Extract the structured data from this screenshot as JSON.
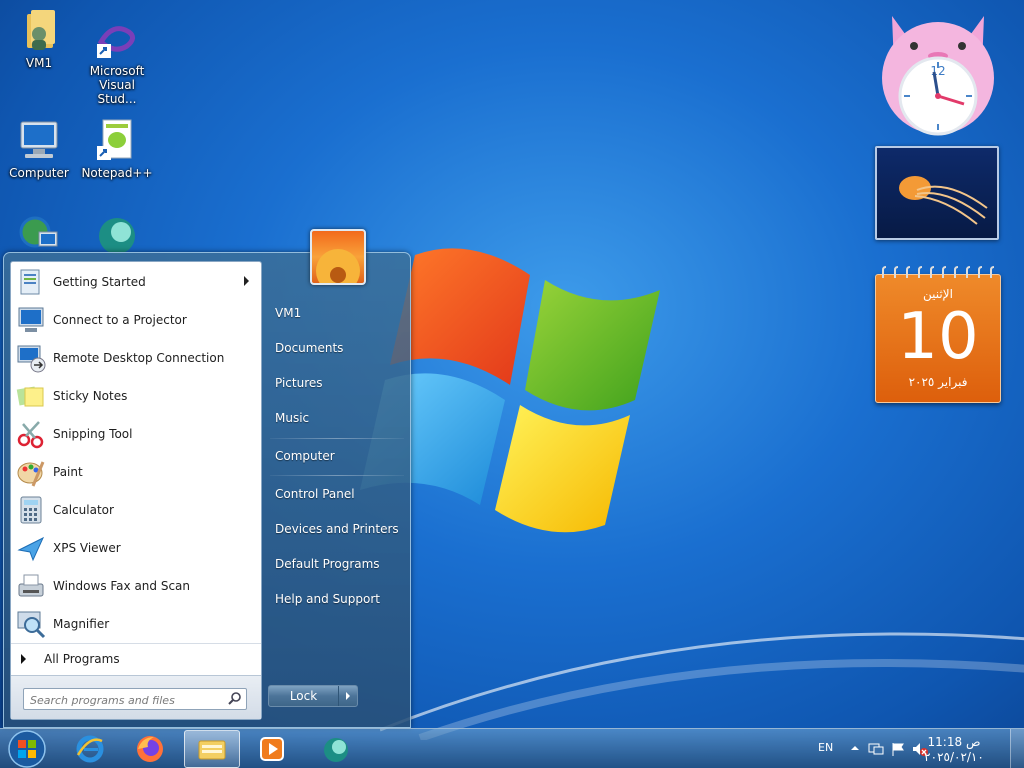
{
  "desktop": {
    "icons": [
      {
        "label": "VM1",
        "icon": "user-folder-icon"
      },
      {
        "label": "Microsoft Visual Stud...",
        "icon": "visual-studio-icon"
      },
      {
        "label": "Computer",
        "icon": "computer-icon"
      },
      {
        "label": "Notepad++",
        "icon": "notepadpp-icon"
      },
      {
        "label": "",
        "icon": "network-icon"
      },
      {
        "label": "",
        "icon": "app-icon"
      }
    ]
  },
  "gadgets": {
    "clock": {
      "hour": 11,
      "minute": 18
    },
    "calendar": {
      "weekday": "الإثنين",
      "day": "10",
      "month_year": "فبراير ٢٠٢٥"
    }
  },
  "start_menu": {
    "programs": [
      {
        "label": "Getting Started",
        "icon": "getting-started-icon",
        "has_submenu": true
      },
      {
        "label": "Connect to a Projector",
        "icon": "projector-icon"
      },
      {
        "label": "Remote Desktop Connection",
        "icon": "remote-desktop-icon"
      },
      {
        "label": "Sticky Notes",
        "icon": "sticky-notes-icon"
      },
      {
        "label": "Snipping Tool",
        "icon": "snipping-tool-icon"
      },
      {
        "label": "Paint",
        "icon": "paint-icon"
      },
      {
        "label": "Calculator",
        "icon": "calculator-icon"
      },
      {
        "label": "XPS Viewer",
        "icon": "xps-viewer-icon"
      },
      {
        "label": "Windows Fax and Scan",
        "icon": "fax-scan-icon"
      },
      {
        "label": "Magnifier",
        "icon": "magnifier-icon"
      }
    ],
    "all_programs": "All Programs",
    "search_placeholder": "Search programs and files",
    "right_items": [
      "VM1",
      "Documents",
      "Pictures",
      "Music",
      "Computer",
      "Control Panel",
      "Devices and Printers",
      "Default Programs",
      "Help and Support"
    ],
    "lock_label": "Lock"
  },
  "taskbar": {
    "apps": [
      "internet-explorer-icon",
      "firefox-icon",
      "file-explorer-icon",
      "media-player-icon",
      "app-icon"
    ],
    "language": "EN",
    "time": "11:18 ص",
    "date": "٢٠٢٥/٠٢/١٠"
  },
  "colors": {
    "accent": "#1a6fd0",
    "calendar": "#e8711e"
  }
}
